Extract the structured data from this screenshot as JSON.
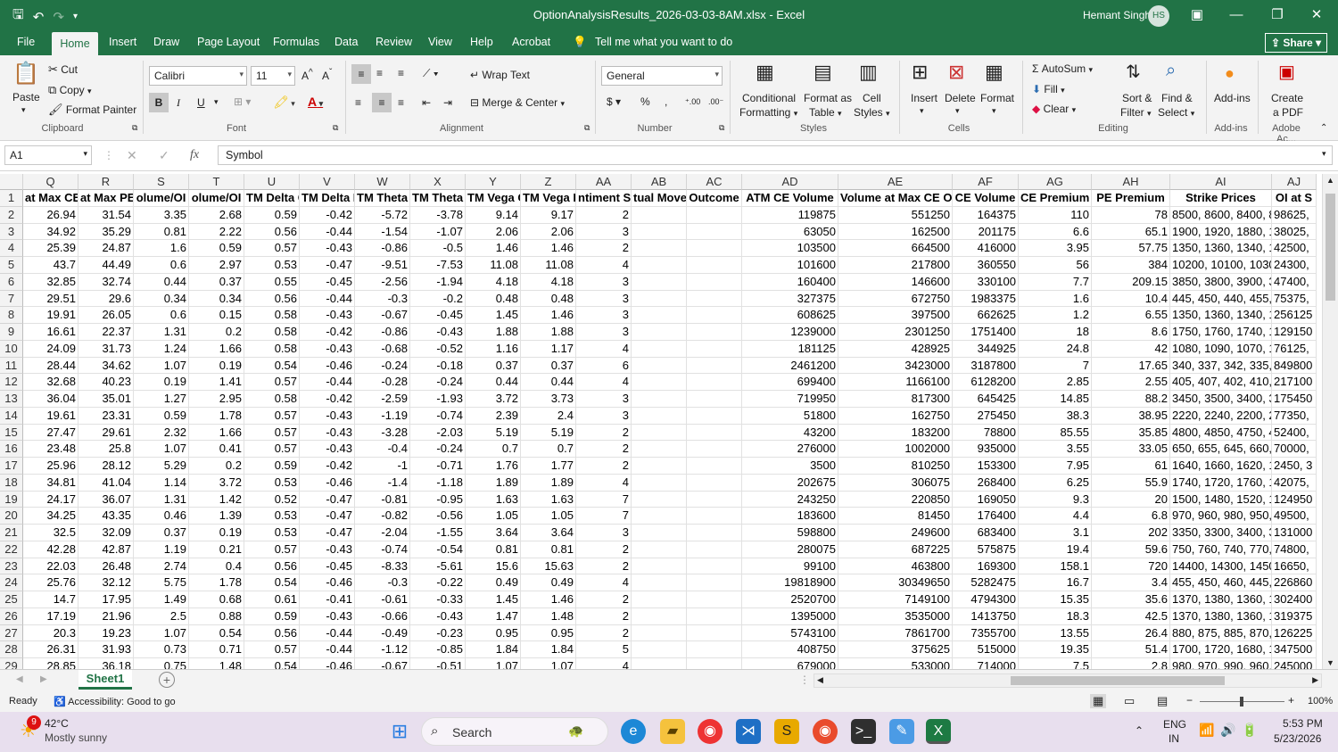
{
  "titlebar": {
    "title": "OptionAnalysisResults_2026-03-03-8AM.xlsx  -  Excel",
    "user": "Hemant Singh",
    "initials": "HS"
  },
  "menu": [
    "File",
    "Home",
    "Insert",
    "Draw",
    "Page Layout",
    "Formulas",
    "Data",
    "Review",
    "View",
    "Help",
    "Acrobat"
  ],
  "tell_me": "Tell me what you want to do",
  "share": "Share",
  "ribbon": {
    "clipboard": {
      "paste": "Paste",
      "cut": "Cut",
      "copy": "Copy",
      "format_painter": "Format Painter",
      "label": "Clipboard"
    },
    "font": {
      "name": "Calibri",
      "size": "11",
      "label": "Font"
    },
    "alignment": {
      "wrap": "Wrap Text",
      "merge": "Merge & Center",
      "label": "Alignment"
    },
    "number": {
      "format": "General",
      "label": "Number"
    },
    "styles": {
      "cond": "Conditional",
      "cond2": "Formatting",
      "fat": "Format as",
      "fat2": "Table",
      "cell": "Cell",
      "cell2": "Styles",
      "label": "Styles"
    },
    "cells": {
      "insert": "Insert",
      "delete": "Delete",
      "format": "Format",
      "label": "Cells"
    },
    "editing": {
      "autosum": "AutoSum",
      "fill": "Fill",
      "clear": "Clear",
      "sort": "Sort &",
      "sort2": "Filter",
      "find": "Find &",
      "find2": "Select",
      "label": "Editing"
    },
    "addins": {
      "btn": "Add-ins",
      "label": "Add-ins"
    },
    "pdf": {
      "btn": "Create",
      "btn2": "a PDF",
      "label": "Adobe Ac..."
    }
  },
  "formula_bar": {
    "namebox": "A1",
    "fx": "fx",
    "content": "Symbol"
  },
  "grid": {
    "columns": [
      "Q",
      "R",
      "S",
      "T",
      "U",
      "V",
      "W",
      "X",
      "Y",
      "Z",
      "AA",
      "AB",
      "AC",
      "AD",
      "AE",
      "AF",
      "AG",
      "AH",
      "AI",
      "AJ"
    ],
    "header_row": [
      "at Max CE",
      "at Max PE",
      "olume/OI",
      "olume/OI",
      "TM Delta C",
      "TM Delta P",
      "TM Theta C",
      "TM Theta P",
      "TM Vega C",
      "TM Vega P",
      "ntiment Sc",
      "tual Move",
      "Outcome",
      "ATM CE Volume",
      "Volume at Max CE OI",
      "CE Volume",
      "CE Premium",
      "PE Premium",
      "Strike Prices",
      "OI at S"
    ],
    "rows": [
      [
        "26.94",
        "31.54",
        "3.35",
        "2.68",
        "0.59",
        "-0.42",
        "-5.72",
        "-3.78",
        "9.14",
        "9.17",
        "2",
        "",
        "",
        "119875",
        "551250",
        "164375",
        "110",
        "78",
        "8500, 8600, 8400, 87",
        "98625,"
      ],
      [
        "34.92",
        "35.29",
        "0.81",
        "2.22",
        "0.56",
        "-0.44",
        "-1.54",
        "-1.07",
        "2.06",
        "2.06",
        "3",
        "",
        "",
        "63050",
        "162500",
        "201175",
        "6.6",
        "65.1",
        "1900, 1920, 1880, 19",
        "38025,"
      ],
      [
        "25.39",
        "24.87",
        "1.6",
        "0.59",
        "0.57",
        "-0.43",
        "-0.86",
        "-0.5",
        "1.46",
        "1.46",
        "2",
        "",
        "",
        "103500",
        "664500",
        "416000",
        "3.95",
        "57.75",
        "1350, 1360, 1340, 13",
        "42500,"
      ],
      [
        "43.7",
        "44.49",
        "0.6",
        "2.97",
        "0.53",
        "-0.47",
        "-9.51",
        "-7.53",
        "11.08",
        "11.08",
        "4",
        "",
        "",
        "101600",
        "217800",
        "360550",
        "56",
        "384",
        "10200, 10100, 10300",
        "24300,"
      ],
      [
        "32.85",
        "32.74",
        "0.44",
        "0.37",
        "0.55",
        "-0.45",
        "-2.56",
        "-1.94",
        "4.18",
        "4.18",
        "3",
        "",
        "",
        "160400",
        "146600",
        "330100",
        "7.7",
        "209.15",
        "3850, 3800, 3900, 37",
        "47400,"
      ],
      [
        "29.51",
        "29.6",
        "0.34",
        "0.34",
        "0.56",
        "-0.44",
        "-0.3",
        "-0.2",
        "0.48",
        "0.48",
        "3",
        "",
        "",
        "327375",
        "672750",
        "1983375",
        "1.6",
        "10.4",
        "445, 450, 440, 455, 4",
        "75375,"
      ],
      [
        "19.91",
        "26.05",
        "0.6",
        "0.15",
        "0.58",
        "-0.43",
        "-0.67",
        "-0.45",
        "1.45",
        "1.46",
        "3",
        "",
        "",
        "608625",
        "397500",
        "662625",
        "1.2",
        "6.55",
        "1350, 1360, 1340, 13",
        "256125"
      ],
      [
        "16.61",
        "22.37",
        "1.31",
        "0.2",
        "0.58",
        "-0.42",
        "-0.86",
        "-0.43",
        "1.88",
        "1.88",
        "3",
        "",
        "",
        "1239000",
        "2301250",
        "1751400",
        "18",
        "8.6",
        "1750, 1760, 1740, 17",
        "129150"
      ],
      [
        "24.09",
        "31.73",
        "1.24",
        "1.66",
        "0.58",
        "-0.43",
        "-0.68",
        "-0.52",
        "1.16",
        "1.17",
        "4",
        "",
        "",
        "181125",
        "428925",
        "344925",
        "24.8",
        "42",
        "1080, 1090, 1070, 11",
        "76125,"
      ],
      [
        "28.44",
        "34.62",
        "1.07",
        "0.19",
        "0.54",
        "-0.46",
        "-0.24",
        "-0.18",
        "0.37",
        "0.37",
        "6",
        "",
        "",
        "2461200",
        "3423000",
        "3187800",
        "7",
        "17.65",
        "340, 337, 342, 335, 3",
        "849800"
      ],
      [
        "32.68",
        "40.23",
        "0.19",
        "1.41",
        "0.57",
        "-0.44",
        "-0.28",
        "-0.24",
        "0.44",
        "0.44",
        "4",
        "",
        "",
        "699400",
        "1166100",
        "6128200",
        "2.85",
        "2.55",
        "405, 407, 402, 410, 4",
        "217100"
      ],
      [
        "36.04",
        "35.01",
        "1.27",
        "2.95",
        "0.58",
        "-0.42",
        "-2.59",
        "-1.93",
        "3.72",
        "3.73",
        "3",
        "",
        "",
        "719950",
        "817300",
        "645425",
        "14.85",
        "88.2",
        "3450, 3500, 3400, 35",
        "175450"
      ],
      [
        "19.61",
        "23.31",
        "0.59",
        "1.78",
        "0.57",
        "-0.43",
        "-1.19",
        "-0.74",
        "2.39",
        "2.4",
        "3",
        "",
        "",
        "51800",
        "162750",
        "275450",
        "38.3",
        "38.95",
        "2220, 2240, 2200, 22",
        "77350,"
      ],
      [
        "27.47",
        "29.61",
        "2.32",
        "1.66",
        "0.57",
        "-0.43",
        "-3.28",
        "-2.03",
        "5.19",
        "5.19",
        "2",
        "",
        "",
        "43200",
        "183200",
        "78800",
        "85.55",
        "35.85",
        "4800, 4850, 4750, 49",
        "52400,"
      ],
      [
        "23.48",
        "25.8",
        "1.07",
        "0.41",
        "0.57",
        "-0.43",
        "-0.4",
        "-0.24",
        "0.7",
        "0.7",
        "2",
        "",
        "",
        "276000",
        "1002000",
        "935000",
        "3.55",
        "33.05",
        "650, 655, 645, 660, 6",
        "70000,"
      ],
      [
        "25.96",
        "28.12",
        "5.29",
        "0.2",
        "0.59",
        "-0.42",
        "-1",
        "-0.71",
        "1.76",
        "1.77",
        "2",
        "",
        "",
        "3500",
        "810250",
        "153300",
        "7.95",
        "61",
        "1640, 1660, 1620, 16",
        "2450, 3"
      ],
      [
        "34.81",
        "41.04",
        "1.14",
        "3.72",
        "0.53",
        "-0.46",
        "-1.4",
        "-1.18",
        "1.89",
        "1.89",
        "4",
        "",
        "",
        "202675",
        "306075",
        "268400",
        "6.25",
        "55.9",
        "1740, 1720, 1760, 17",
        "42075,"
      ],
      [
        "24.17",
        "36.07",
        "1.31",
        "1.42",
        "0.52",
        "-0.47",
        "-0.81",
        "-0.95",
        "1.63",
        "1.63",
        "7",
        "",
        "",
        "243250",
        "220850",
        "169050",
        "9.3",
        "20",
        "1500, 1480, 1520, 14",
        "124950"
      ],
      [
        "34.25",
        "43.35",
        "0.46",
        "1.39",
        "0.53",
        "-0.47",
        "-0.82",
        "-0.56",
        "1.05",
        "1.05",
        "7",
        "",
        "",
        "183600",
        "81450",
        "176400",
        "4.4",
        "6.8",
        "970, 960, 980, 950, 9",
        "49500,"
      ],
      [
        "32.5",
        "32.09",
        "0.37",
        "0.19",
        "0.53",
        "-0.47",
        "-2.04",
        "-1.55",
        "3.64",
        "3.64",
        "3",
        "",
        "",
        "598800",
        "249600",
        "683400",
        "3.1",
        "202",
        "3350, 3300, 3400, 32",
        "131000"
      ],
      [
        "42.28",
        "42.87",
        "1.19",
        "0.21",
        "0.57",
        "-0.43",
        "-0.74",
        "-0.54",
        "0.81",
        "0.81",
        "2",
        "",
        "",
        "280075",
        "687225",
        "575875",
        "19.4",
        "59.6",
        "750, 760, 740, 770, 7",
        "74800,"
      ],
      [
        "22.03",
        "26.48",
        "2.74",
        "0.4",
        "0.56",
        "-0.45",
        "-8.33",
        "-5.61",
        "15.6",
        "15.63",
        "2",
        "",
        "",
        "99100",
        "463800",
        "169300",
        "158.1",
        "720",
        "14400, 14300, 14500",
        "16650,"
      ],
      [
        "25.76",
        "32.12",
        "5.75",
        "1.78",
        "0.54",
        "-0.46",
        "-0.3",
        "-0.22",
        "0.49",
        "0.49",
        "4",
        "",
        "",
        "19818900",
        "30349650",
        "5282475",
        "16.7",
        "3.4",
        "455, 450, 460, 445, 4",
        "226860"
      ],
      [
        "14.7",
        "17.95",
        "1.49",
        "0.68",
        "0.61",
        "-0.41",
        "-0.61",
        "-0.33",
        "1.45",
        "1.46",
        "2",
        "",
        "",
        "2520700",
        "7149100",
        "4794300",
        "15.35",
        "35.6",
        "1370, 1380, 1360, 13",
        "302400"
      ],
      [
        "17.19",
        "21.96",
        "2.5",
        "0.88",
        "0.59",
        "-0.43",
        "-0.66",
        "-0.43",
        "1.47",
        "1.48",
        "2",
        "",
        "",
        "1395000",
        "3535000",
        "1413750",
        "18.3",
        "42.5",
        "1370, 1380, 1360, 13",
        "319375"
      ],
      [
        "20.3",
        "19.23",
        "1.07",
        "0.54",
        "0.56",
        "-0.44",
        "-0.49",
        "-0.23",
        "0.95",
        "0.95",
        "2",
        "",
        "",
        "5743100",
        "7861700",
        "7355700",
        "13.55",
        "26.4",
        "880, 875, 885, 870, 8",
        "126225"
      ],
      [
        "26.31",
        "31.93",
        "0.73",
        "0.71",
        "0.57",
        "-0.44",
        "-1.12",
        "-0.85",
        "1.84",
        "1.84",
        "5",
        "",
        "",
        "408750",
        "375625",
        "515000",
        "19.35",
        "51.4",
        "1700, 1720, 1680, 17",
        "347500"
      ],
      [
        "28.85",
        "36.18",
        "0.75",
        "1.48",
        "0.54",
        "-0.46",
        "-0.67",
        "-0.51",
        "1.07",
        "1.07",
        "4",
        "",
        "",
        "679000",
        "533000",
        "714000",
        "7.5",
        "2.8",
        "980, 970, 990, 960, 1",
        "245000"
      ]
    ]
  },
  "sheet": {
    "tab": "Sheet1"
  },
  "status": {
    "ready": "Ready",
    "accessibility": "Accessibility: Good to go",
    "zoom": "100%"
  },
  "taskbar": {
    "temp": "42°C",
    "weather": "Mostly sunny",
    "badge": "9",
    "search": "Search",
    "lang1": "ENG",
    "lang2": "IN",
    "time": "5:53 PM",
    "date": "5/23/2026"
  }
}
